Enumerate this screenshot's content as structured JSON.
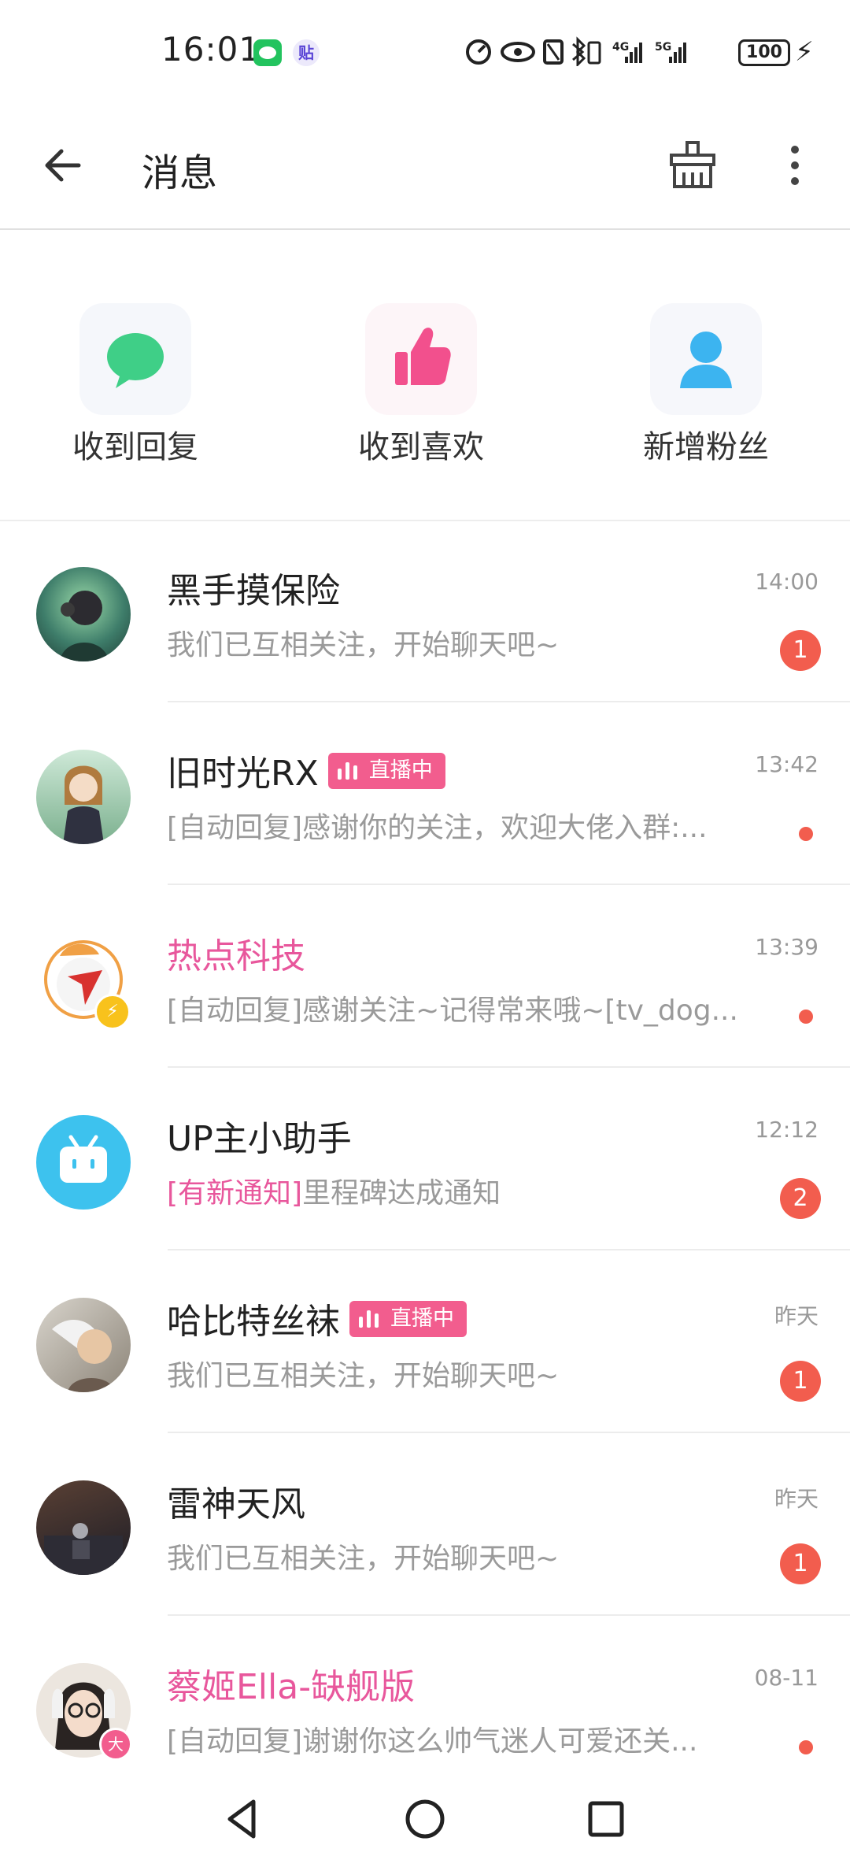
{
  "status": {
    "time": "16:01",
    "tie_icon_text": "贴",
    "battery": "100"
  },
  "appbar": {
    "title": "消息"
  },
  "shortcuts": [
    {
      "label": "收到回复",
      "icon": "chat-bubble-icon",
      "color": "#3fcf87"
    },
    {
      "label": "收到喜欢",
      "icon": "thumbs-up-icon",
      "color": "#f2508d"
    },
    {
      "label": "新增粉丝",
      "icon": "person-icon",
      "color": "#3cb4f0"
    }
  ],
  "conversations": [
    {
      "name": "黑手摸保险",
      "message": "我们已互相关注，开始聊天吧~",
      "time": "14:00",
      "badge": "1",
      "live": "",
      "name_color": "default"
    },
    {
      "name": "旧时光RX",
      "message": "[自动回复]感谢你的关注，欢迎大佬入群:...",
      "time": "13:42",
      "badge": "",
      "dot": true,
      "live": "直播中",
      "name_color": "default"
    },
    {
      "name": "热点科技",
      "message": "[自动回复]感谢关注~记得常来哦~[tv_dog...",
      "time": "13:39",
      "badge": "",
      "dot": true,
      "live": "",
      "name_color": "pink"
    },
    {
      "name": "UP主小助手",
      "message_tag": "[有新通知]",
      "message": "里程碑达成通知",
      "time": "12:12",
      "badge": "2",
      "live": "",
      "name_color": "default"
    },
    {
      "name": "哈比特丝袜",
      "message": "我们已互相关注，开始聊天吧~",
      "time": "昨天",
      "badge": "1",
      "live": "直播中",
      "name_color": "default"
    },
    {
      "name": "雷神天风",
      "message": "我们已互相关注，开始聊天吧~",
      "time": "昨天",
      "badge": "1",
      "live": "",
      "name_color": "default"
    },
    {
      "name": "蔡姬Ella-缺舰版",
      "message": "[自动回复]谢谢你这么帅气迷人可爱还关...",
      "time": "08-11",
      "badge": "",
      "dot": true,
      "live": "",
      "name_color": "pink"
    }
  ],
  "badges": {
    "verified_bolt": "⚡",
    "big_member": "大"
  },
  "colors": {
    "accent_pink": "#f25d8e",
    "badge_red": "#f25d4e"
  }
}
